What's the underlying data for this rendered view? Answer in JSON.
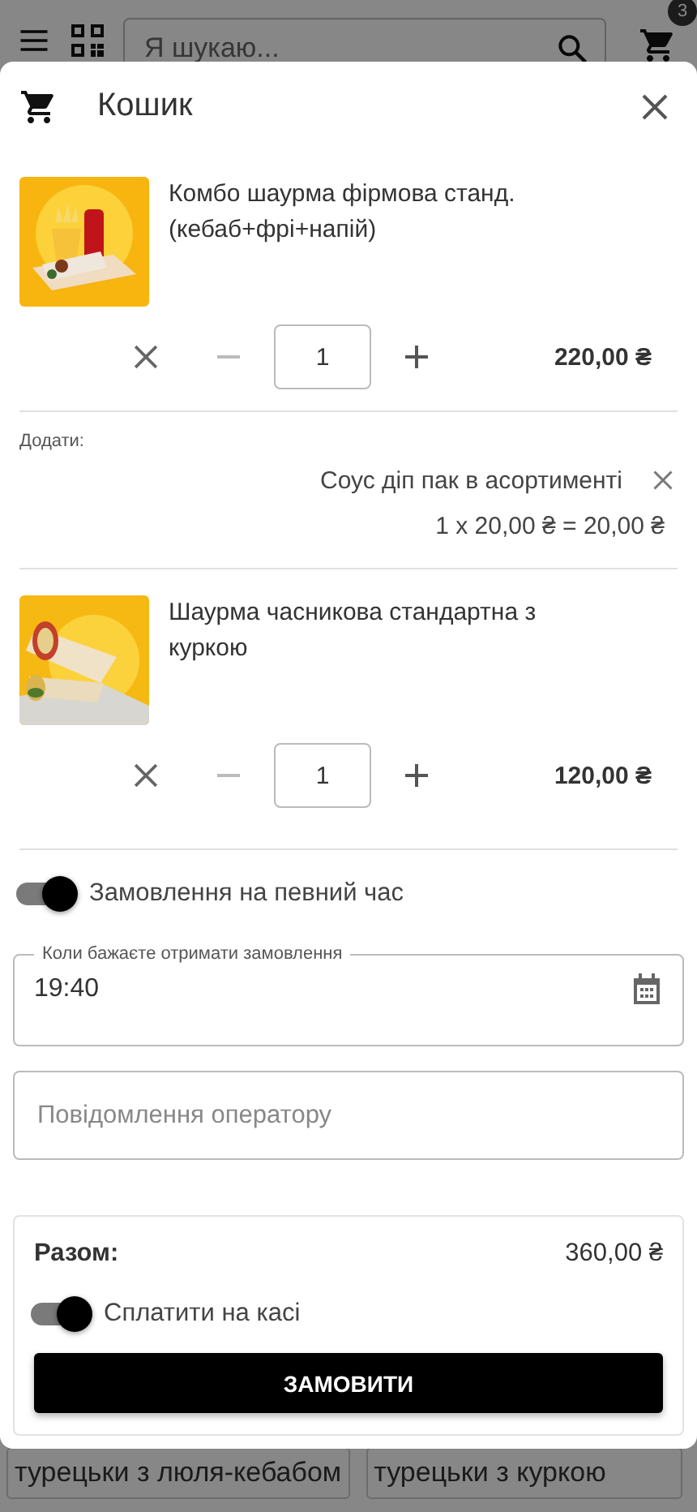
{
  "header": {
    "search": {
      "placeholder": "Я шукаю..."
    },
    "cart_badge": "3"
  },
  "dialog": {
    "title": "Кошик",
    "items": [
      {
        "name": "Комбо шаурма фірмова станд. (кебаб+фрі+напій)",
        "quantity": "1",
        "price": "220,00 ₴",
        "addons_label": "Додати:",
        "addons": [
          {
            "name": "Соус діп пак в асортименті",
            "calc": "1 x 20,00 ₴ = 20,00 ₴"
          }
        ]
      },
      {
        "name": "Шаурма часникова стандартна з куркою",
        "quantity": "1",
        "price": "120,00 ₴"
      }
    ],
    "scheduled": {
      "label": "Замовлення на певний час",
      "on": true
    },
    "time_field": {
      "label": "Коли бажаєте отримати замовлення",
      "value": "19:40"
    },
    "message_field": {
      "placeholder": "Повідомлення оператору"
    },
    "summary": {
      "total_label": "Разом:",
      "total": "360,00 ₴",
      "pay_at_cashier": {
        "label": "Сплатити на касі",
        "on": true
      },
      "order_button": "ЗАМОВИТИ"
    }
  },
  "background_cards": [
    {
      "title": "турецьки з люля-кебабом"
    },
    {
      "title": "турецьки з куркою"
    }
  ]
}
